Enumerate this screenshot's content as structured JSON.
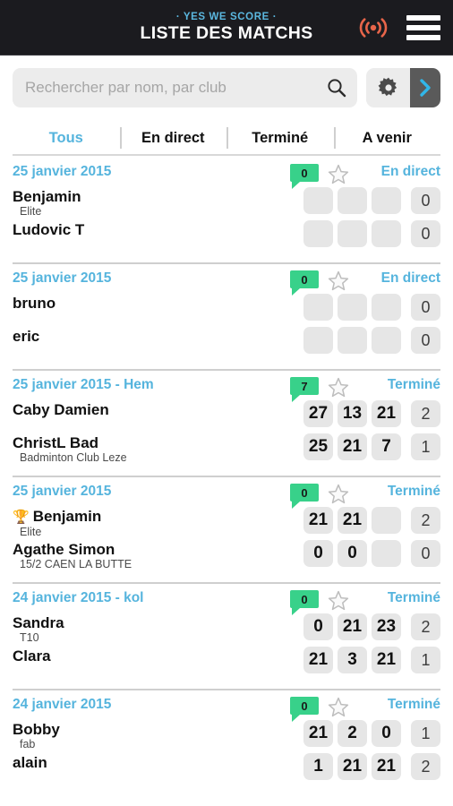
{
  "header": {
    "supertitle": "· YES WE SCORE ·",
    "title": "LISTE DES MATCHS",
    "live_icon": "broadcast-icon",
    "menu_icon": "hamburger-menu-icon",
    "accent_blue": "#5bb8e0",
    "live_orange": "#e8654a",
    "background": "#1b1b1f"
  },
  "search": {
    "placeholder": "Rechercher par nom, par club",
    "value": "",
    "icon": "search-icon",
    "gear_icon": "gear-icon",
    "next_icon": "chevron-right-icon"
  },
  "tabs": [
    {
      "label": "Tous",
      "active": true
    },
    {
      "label": "En direct",
      "active": false
    },
    {
      "label": "Terminé",
      "active": false
    },
    {
      "label": "A venir",
      "active": false
    }
  ],
  "matches": [
    {
      "date": "25 janvier 2015",
      "comments": "0",
      "status": "En direct",
      "starred": false,
      "players": [
        {
          "name": "Benjamin",
          "sub": "Elite",
          "winner": false,
          "sets": [
            "",
            "",
            ""
          ],
          "total": "0"
        },
        {
          "name": "Ludovic T",
          "sub": "",
          "winner": false,
          "sets": [
            "",
            "",
            ""
          ],
          "total": "0"
        }
      ]
    },
    {
      "date": "25 janvier 2015",
      "comments": "0",
      "status": "En direct",
      "starred": false,
      "players": [
        {
          "name": "bruno",
          "sub": "",
          "winner": false,
          "sets": [
            "",
            "",
            ""
          ],
          "total": "0"
        },
        {
          "name": "eric",
          "sub": "",
          "winner": false,
          "sets": [
            "",
            "",
            ""
          ],
          "total": "0"
        }
      ]
    },
    {
      "date": "25 janvier 2015 - Hem",
      "comments": "7",
      "status": "Terminé",
      "starred": false,
      "players": [
        {
          "name": "Caby Damien",
          "sub": "",
          "winner": false,
          "sets": [
            "27",
            "13",
            "21"
          ],
          "total": "2"
        },
        {
          "name": "ChristL Bad",
          "sub": "Badminton Club Leze",
          "winner": false,
          "sets": [
            "25",
            "21",
            "7"
          ],
          "total": "1"
        }
      ]
    },
    {
      "date": "25 janvier 2015",
      "comments": "0",
      "status": "Terminé",
      "starred": false,
      "players": [
        {
          "name": "Benjamin",
          "sub": "Elite",
          "winner": true,
          "sets": [
            "21",
            "21",
            ""
          ],
          "total": "2"
        },
        {
          "name": "Agathe Simon",
          "sub": "15/2 CAEN LA BUTTE",
          "winner": false,
          "sets": [
            "0",
            "0",
            ""
          ],
          "total": "0"
        }
      ]
    },
    {
      "date": "24 janvier 2015 - kol",
      "comments": "0",
      "status": "Terminé",
      "starred": false,
      "players": [
        {
          "name": "Sandra",
          "sub": "T10",
          "winner": false,
          "sets": [
            "0",
            "21",
            "23"
          ],
          "total": "2"
        },
        {
          "name": "Clara",
          "sub": "",
          "winner": false,
          "sets": [
            "21",
            "3",
            "21"
          ],
          "total": "1"
        }
      ]
    },
    {
      "date": "24 janvier 2015",
      "comments": "0",
      "status": "Terminé",
      "starred": false,
      "players": [
        {
          "name": "Bobby",
          "sub": "fab",
          "winner": false,
          "sets": [
            "21",
            "2",
            "0"
          ],
          "total": "1"
        },
        {
          "name": "alain",
          "sub": "",
          "winner": false,
          "sets": [
            "1",
            "21",
            "21"
          ],
          "total": "2"
        }
      ]
    }
  ],
  "colors": {
    "date_blue": "#55b4dd",
    "status_blue": "#55b4dd",
    "comment_green": "#38d18a",
    "cell_gray": "#e6e6e6",
    "star_outline": "#bdbdbd"
  }
}
